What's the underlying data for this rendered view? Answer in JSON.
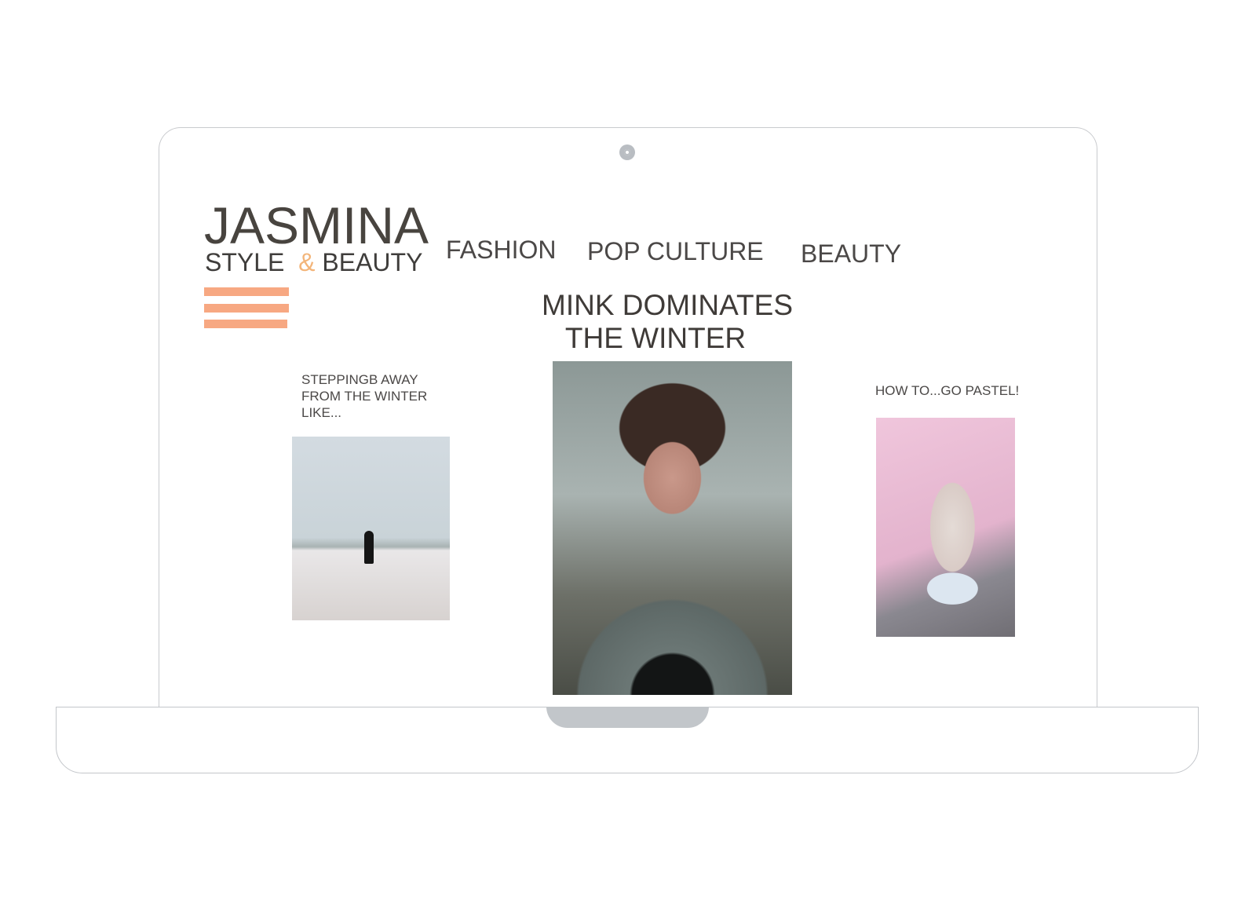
{
  "brand": {
    "name": "JASMINA",
    "tagline_left": "STYLE",
    "tagline_amp": "&",
    "tagline_right": "BEAUTY"
  },
  "nav": [
    {
      "label": "FASHION"
    },
    {
      "label": "POP CULTURE"
    },
    {
      "label": "BEAUTY"
    }
  ],
  "featured": {
    "title_line1": "MINK DOMINATES",
    "title_line2": "THE WINTER"
  },
  "articles": [
    {
      "title_line1": "STEPPINGB AWAY",
      "title_line2": "FROM THE WINTER",
      "title_line3": "LIKE..."
    },
    {
      "title": "HOW TO...GO PASTEL!"
    }
  ],
  "colors": {
    "accent": "#f7a882",
    "amp": "#f3b57a",
    "text": "#45423f"
  }
}
